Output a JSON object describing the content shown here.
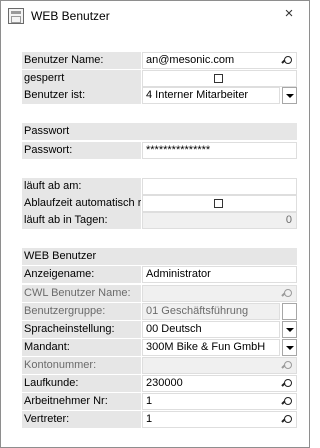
{
  "window": {
    "title": "WEB Benutzer",
    "close": "×"
  },
  "login": {
    "benutzer_name": {
      "label": "Benutzer Name:",
      "value": "an@mesonic.com"
    },
    "gesperrt": {
      "label": "gesperrt"
    },
    "benutzer_ist": {
      "label": "Benutzer ist:",
      "value": "4 Interner Mitarbeiter"
    }
  },
  "passwort_section": {
    "header": "Passwort",
    "passwort": {
      "label": "Passwort:",
      "value": "***************"
    }
  },
  "expiry": {
    "laeuft_ab_am": {
      "label": "läuft ab am:",
      "value": ""
    },
    "ablaufzeit": {
      "label": "Ablaufzeit automatisch r",
      "value": ""
    },
    "laeuft_ab_tage": {
      "label": "läuft ab in Tagen:",
      "value": "0"
    }
  },
  "web_section": {
    "header": "WEB Benutzer",
    "anzeigename": {
      "label": "Anzeigename:",
      "value": "Administrator"
    },
    "cwl_benutzer": {
      "label": "CWL Benutzer Name:",
      "value": ""
    },
    "benutzergruppe": {
      "label": "Benutzergruppe:",
      "value": "01 Geschäftsführung"
    },
    "spracheinstellung": {
      "label": "Spracheinstellung:",
      "value": "00 Deutsch"
    },
    "mandant": {
      "label": "Mandant:",
      "value": "300M Bike & Fun GmbH"
    },
    "kontonummer": {
      "label": "Kontonummer:",
      "value": ""
    },
    "laufkunde": {
      "label": "Laufkunde:",
      "value": "230000"
    },
    "arbeitnehmer": {
      "label": "Arbeitnehmer Nr:",
      "value": "1"
    },
    "vertreter": {
      "label": "Vertreter:",
      "value": "1"
    }
  },
  "icons": {
    "search": "magnifier-icon",
    "dropdown": "chevron-down-icon",
    "checkbox": "checkbox"
  }
}
